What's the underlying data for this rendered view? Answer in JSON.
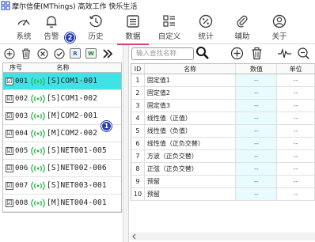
{
  "window": {
    "title": "摩尔信使(MThings) 高效工作 快乐生活"
  },
  "toolbar": {
    "items": [
      {
        "label": "系统"
      },
      {
        "label": "告警"
      },
      {
        "label": "历史"
      },
      {
        "label": "数据"
      },
      {
        "label": "自定义"
      },
      {
        "label": "统计"
      },
      {
        "label": "辅助"
      },
      {
        "label": "关于"
      }
    ],
    "active": "数据"
  },
  "left_toolbar": {
    "btn_r": "R",
    "btn_w": "W"
  },
  "badges": {
    "one": "1",
    "two": "2"
  },
  "device_table": {
    "headers": {
      "index": "序号",
      "name": "名称"
    },
    "rows": [
      {
        "checked": "☑",
        "index": "001",
        "name": "[S]COM1-001",
        "selected": true
      },
      {
        "checked": "☑",
        "index": "002",
        "name": "[S]COM1-002"
      },
      {
        "checked": "☑",
        "index": "003",
        "name": "[M]COM2-001"
      },
      {
        "checked": "☑",
        "index": "004",
        "name": "[M]COM2-002"
      },
      {
        "checked": "☑",
        "index": "005",
        "name": "[S]NET001-005"
      },
      {
        "checked": "☑",
        "index": "006",
        "name": "[S]NET002-006"
      },
      {
        "checked": "☑",
        "index": "007",
        "name": "[S]NET003-001"
      },
      {
        "checked": "☑",
        "index": "008",
        "name": "[M]NET004-001"
      }
    ]
  },
  "search": {
    "placeholder": "输入查找名称"
  },
  "data_table": {
    "headers": {
      "id": "ID",
      "name": "名称",
      "value": "数值",
      "unit": "单位"
    },
    "rows": [
      {
        "id": "1",
        "name": "固定值1",
        "value": "--",
        "unit": "--"
      },
      {
        "id": "2",
        "name": "固定值2",
        "value": "--",
        "unit": "--"
      },
      {
        "id": "3",
        "name": "固定值3",
        "value": "--",
        "unit": "--"
      },
      {
        "id": "4",
        "name": "线性值（正值）",
        "value": "--",
        "unit": "--"
      },
      {
        "id": "5",
        "name": "线性值（负值）",
        "value": "--",
        "unit": "--"
      },
      {
        "id": "6",
        "name": "线性值（正负交替）",
        "value": "--",
        "unit": "--"
      },
      {
        "id": "7",
        "name": "方波（正负交替）",
        "value": "--",
        "unit": "--"
      },
      {
        "id": "8",
        "name": "正弦（正负交替）",
        "value": "--",
        "unit": "--"
      },
      {
        "id": "9",
        "name": "预留",
        "value": "--",
        "unit": "--"
      },
      {
        "id": "10",
        "name": "预留",
        "value": "--",
        "unit": "--"
      }
    ]
  },
  "colors": {
    "selected_row": "#3fe3e6",
    "active_tab_underline": "#e0407a",
    "badge": "#2a3fb5",
    "signal": "#2db84a",
    "value_cell": "#e8fbfe"
  }
}
